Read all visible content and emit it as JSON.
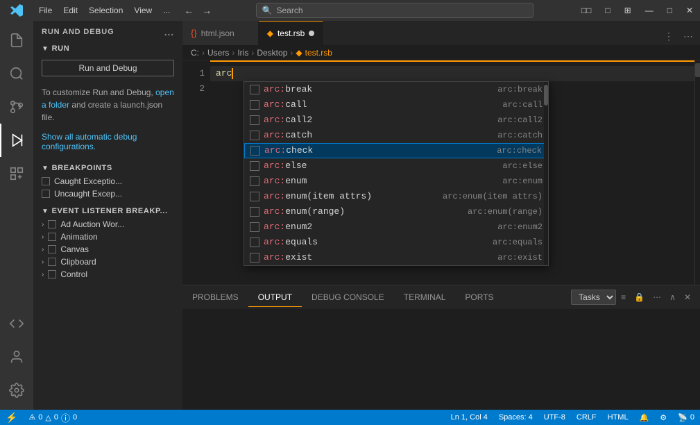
{
  "titlebar": {
    "menus": [
      "File",
      "Edit",
      "Selection",
      "View",
      "..."
    ],
    "nav_back": "←",
    "nav_forward": "→",
    "search_placeholder": "Search",
    "controls": [
      "□□",
      "□",
      "□□□",
      "—",
      "□",
      "✕"
    ]
  },
  "activity": {
    "items": [
      {
        "name": "explorer-icon",
        "label": "Explorer",
        "icon": "files"
      },
      {
        "name": "search-activity-icon",
        "label": "Search",
        "icon": "search"
      },
      {
        "name": "source-control-icon",
        "label": "Source Control",
        "icon": "git"
      },
      {
        "name": "run-debug-activity-icon",
        "label": "Run and Debug",
        "icon": "run",
        "active": true
      },
      {
        "name": "extensions-icon",
        "label": "Extensions",
        "icon": "ext"
      }
    ],
    "bottom": [
      {
        "name": "remote-icon",
        "label": "Remote"
      },
      {
        "name": "account-icon",
        "label": "Account"
      },
      {
        "name": "settings-icon",
        "label": "Settings"
      }
    ]
  },
  "sidebar": {
    "title": "RUN AND DEBUG",
    "more_icon": "...",
    "run_section": {
      "label": "RUN",
      "chevron": "▼",
      "button": "Run and Debug",
      "description_parts": [
        "To customize Run and",
        "Debug, "
      ],
      "link_text": "open a folder",
      "description_end": " and create a launch.json file.",
      "show_link": "Show all automatic debug configurations."
    },
    "breakpoints": {
      "label": "BREAKPOINTS",
      "chevron": "▼",
      "items": [
        {
          "id": "caught",
          "label": "Caught Exceptio...",
          "checked": false
        },
        {
          "id": "uncaught",
          "label": "Uncaught Excep...",
          "checked": false
        }
      ]
    },
    "event_listeners": {
      "label": "EVENT LISTENER BREAKP...",
      "chevron": "▼",
      "items": [
        {
          "id": "ad-auction",
          "label": "Ad Auction Wor...",
          "has_checkbox": true
        },
        {
          "id": "animation",
          "label": "Animation",
          "has_checkbox": true
        },
        {
          "id": "canvas",
          "label": "Canvas",
          "has_checkbox": true
        },
        {
          "id": "clipboard",
          "label": "Clipboard",
          "has_checkbox": true
        },
        {
          "id": "control",
          "label": "Control",
          "has_checkbox": true
        }
      ]
    }
  },
  "tabs": [
    {
      "id": "html-json",
      "label": "html.json",
      "icon": "{ }",
      "active": false,
      "dot": false
    },
    {
      "id": "test-rsb",
      "label": "test.rsb",
      "icon": "◆",
      "active": true,
      "dot": true
    }
  ],
  "breadcrumb": {
    "parts": [
      "C:",
      "Users",
      "Iris",
      "Desktop",
      "◆",
      "test.rsb"
    ]
  },
  "editor": {
    "lines": [
      {
        "number": "1",
        "content": "arc",
        "cursor": true
      },
      {
        "number": "2",
        "content": "",
        "cursor": false
      }
    ]
  },
  "autocomplete": {
    "items": [
      {
        "id": "break",
        "label_prefix": "arc:",
        "label_main": "break",
        "hint": "arc:break"
      },
      {
        "id": "call",
        "label_prefix": "arc:",
        "label_main": "call",
        "hint": "arc:call"
      },
      {
        "id": "call2",
        "label_prefix": "arc:",
        "label_main": "call2",
        "hint": "arc:call2"
      },
      {
        "id": "catch",
        "label_prefix": "arc:",
        "label_main": "catch",
        "hint": "arc:catch"
      },
      {
        "id": "check",
        "label_prefix": "arc:",
        "label_main": "check",
        "hint": "arc:check",
        "selected": true
      },
      {
        "id": "else",
        "label_prefix": "arc:",
        "label_main": "else",
        "hint": "arc:else"
      },
      {
        "id": "enum",
        "label_prefix": "arc:",
        "label_main": "enum",
        "hint": "arc:enum"
      },
      {
        "id": "enum-item",
        "label_prefix": "arc:",
        "label_main": "enum(item attrs)",
        "hint": "arc:enum(item attrs)"
      },
      {
        "id": "enum-range",
        "label_prefix": "arc:",
        "label_main": "enum(range)",
        "hint": "arc:enum(range)"
      },
      {
        "id": "enum2",
        "label_prefix": "arc:",
        "label_main": "enum2",
        "hint": "arc:enum2"
      },
      {
        "id": "equals",
        "label_prefix": "arc:",
        "label_main": "equals",
        "hint": "arc:equals"
      },
      {
        "id": "exist",
        "label_prefix": "arc:",
        "label_main": "exist",
        "hint": "arc:exist"
      }
    ]
  },
  "panel": {
    "tabs": [
      {
        "id": "problems",
        "label": "PROBLEMS"
      },
      {
        "id": "output",
        "label": "OUTPUT",
        "active": true
      },
      {
        "id": "debug-console",
        "label": "DEBUG CONSOLE"
      },
      {
        "id": "terminal",
        "label": "TERMINAL"
      },
      {
        "id": "ports",
        "label": "PORTS"
      }
    ],
    "task_select": "Tasks",
    "actions": [
      "≡",
      "🔒",
      "...",
      "∧",
      "✕"
    ]
  },
  "statusbar": {
    "left": [
      {
        "id": "remote",
        "icon": "⚡",
        "label": ""
      },
      {
        "id": "errors",
        "icon": "⊗",
        "label": "0"
      },
      {
        "id": "warnings",
        "icon": "⚠",
        "label": "0"
      },
      {
        "id": "info",
        "icon": "ℹ",
        "label": "0"
      }
    ],
    "right": [
      {
        "id": "position",
        "label": "Ln 1, Col 4"
      },
      {
        "id": "spaces",
        "label": "Spaces: 4"
      },
      {
        "id": "encoding",
        "label": "UTF-8"
      },
      {
        "id": "line-ending",
        "label": "CRLF"
      },
      {
        "id": "language",
        "label": "HTML"
      },
      {
        "id": "notifications",
        "icon": "🔔",
        "label": ""
      },
      {
        "id": "debug-icon",
        "icon": "⚙",
        "label": ""
      },
      {
        "id": "broadcast",
        "icon": "📡",
        "label": "0"
      }
    ]
  }
}
